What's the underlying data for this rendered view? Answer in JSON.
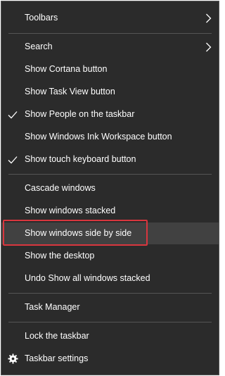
{
  "menu": {
    "items": [
      {
        "label": "Toolbars",
        "has_submenu": true,
        "checked": false
      },
      {
        "label": "Search",
        "has_submenu": true,
        "checked": false
      },
      {
        "label": "Show Cortana button",
        "checked": false
      },
      {
        "label": "Show Task View button",
        "checked": false
      },
      {
        "label": "Show People on the taskbar",
        "checked": true
      },
      {
        "label": "Show Windows Ink Workspace button",
        "checked": false
      },
      {
        "label": "Show touch keyboard button",
        "checked": true
      },
      {
        "label": "Cascade windows",
        "checked": false
      },
      {
        "label": "Show windows stacked",
        "checked": false
      },
      {
        "label": "Show windows side by side",
        "checked": false,
        "highlighted": true
      },
      {
        "label": "Show the desktop",
        "checked": false
      },
      {
        "label": "Undo Show all windows stacked",
        "checked": false
      },
      {
        "label": "Task Manager",
        "checked": false
      },
      {
        "label": "Lock the taskbar",
        "checked": false
      },
      {
        "label": "Taskbar settings",
        "icon": "gear-icon",
        "checked": false
      }
    ]
  },
  "colors": {
    "menu_background": "#2b2b2b",
    "hover_background": "#414141",
    "text": "#ffffff",
    "separator": "#555555",
    "highlight_border": "#d9363e"
  }
}
